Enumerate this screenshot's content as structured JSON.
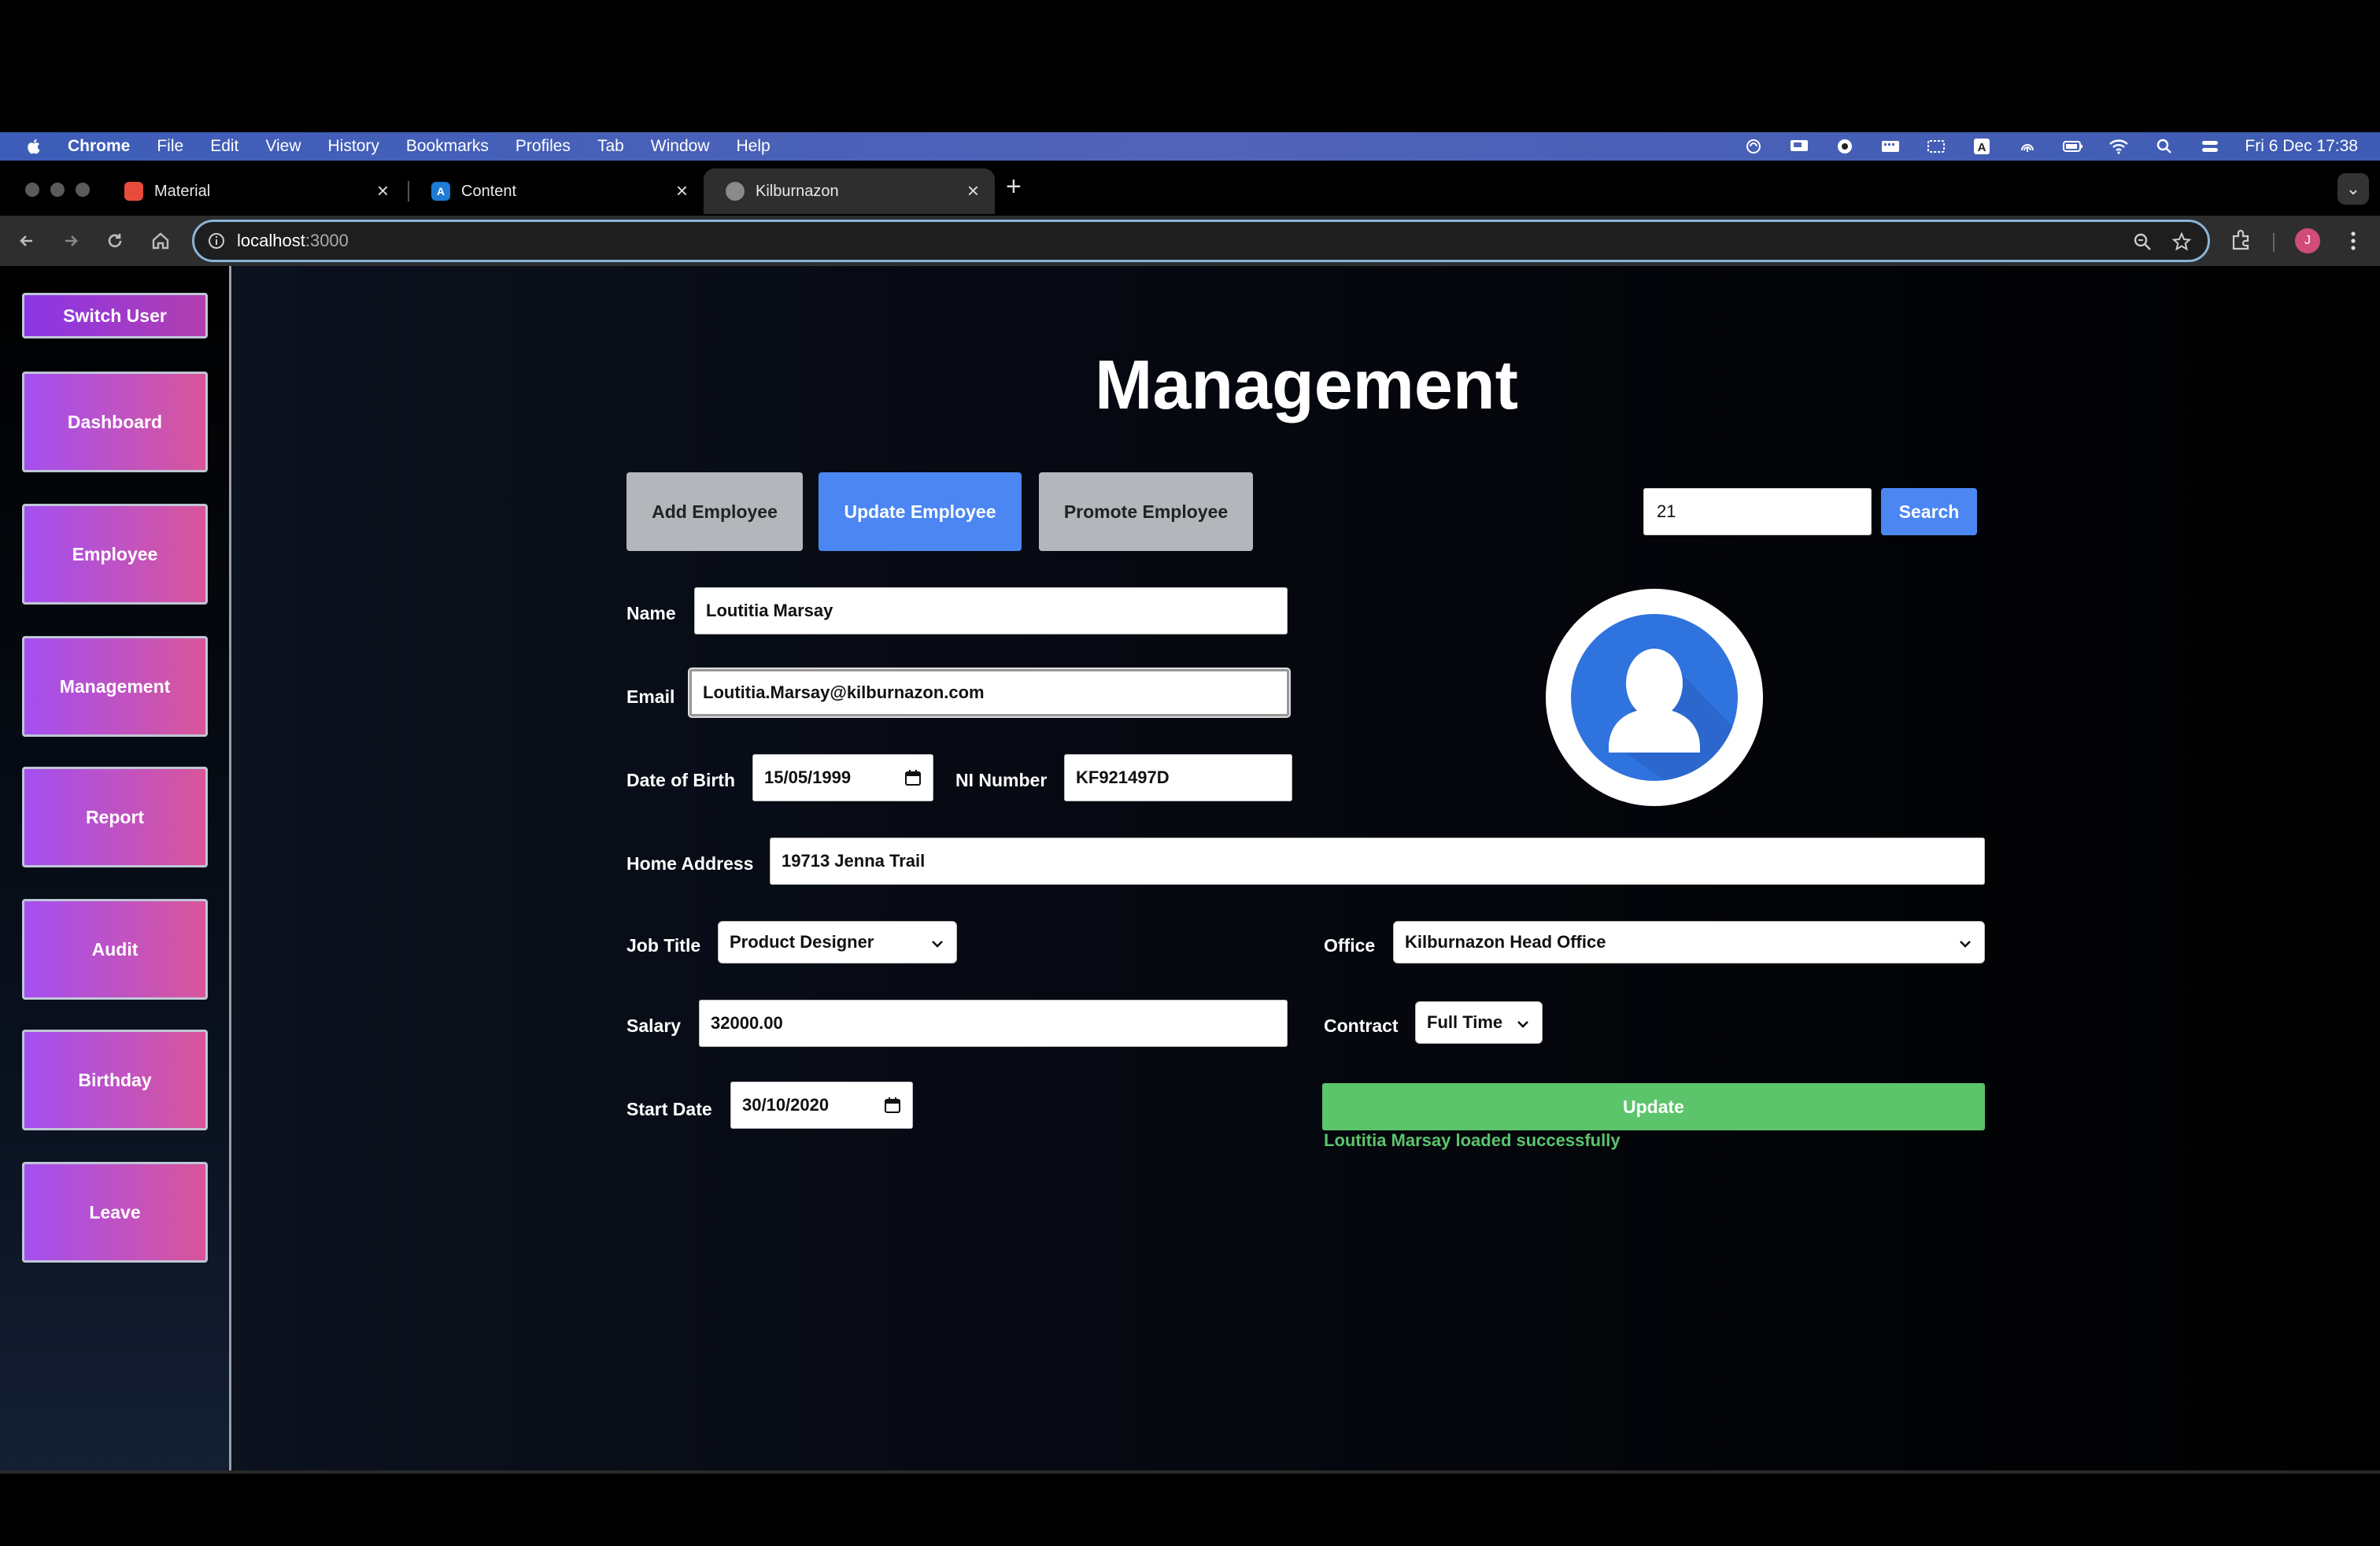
{
  "os_menubar": {
    "app_name": "Chrome",
    "menus": [
      "File",
      "Edit",
      "View",
      "History",
      "Bookmarks",
      "Profiles",
      "Tab",
      "Window",
      "Help"
    ],
    "clock": "Fri 6 Dec  17:38"
  },
  "browser": {
    "tabs": [
      {
        "title": "Material",
        "favicon_color": "#e84b3c"
      },
      {
        "title": "Content",
        "favicon_color": "#1e7bd6"
      },
      {
        "title": "Kilburnazon",
        "favicon_color": "#9a9a9a"
      }
    ],
    "active_tab": 2,
    "url_host": "localhost",
    "url_port": ":3000",
    "profile_initial": "J"
  },
  "sidebar": {
    "switch_user": "Switch User",
    "items": [
      "Dashboard",
      "Employee",
      "Management",
      "Report",
      "Audit",
      "Birthday",
      "Leave"
    ]
  },
  "page": {
    "title": "Management",
    "tabs": {
      "add": "Add Employee",
      "update": "Update Employee",
      "promote": "Promote Employee"
    },
    "active_tab": "update",
    "search": {
      "value": "21",
      "button": "Search"
    }
  },
  "form": {
    "name_label": "Name",
    "name_value": "Loutitia Marsay",
    "email_label": "Email",
    "email_value": "Loutitia.Marsay@kilburnazon.com",
    "dob_label": "Date of Birth",
    "dob_value": "15/05/1999",
    "ni_label": "NI Number",
    "ni_value": "KF921497D",
    "address_label": "Home Address",
    "address_value": "19713 Jenna Trail",
    "job_label": "Job Title",
    "job_value": "Product Designer",
    "office_label": "Office",
    "office_value": "Kilburnazon Head Office",
    "salary_label": "Salary",
    "salary_value": "32000.00",
    "contract_label": "Contract",
    "contract_value": "Full Time",
    "start_label": "Start Date",
    "start_value": "30/10/2020",
    "update_button": "Update",
    "status_message": "Loutitia Marsay loaded successfully"
  },
  "colors": {
    "accent_blue": "#4b86f2",
    "success_green": "#5cc46b",
    "nav_gradient_start": "#a34ff0",
    "nav_gradient_end": "#d9559a"
  }
}
